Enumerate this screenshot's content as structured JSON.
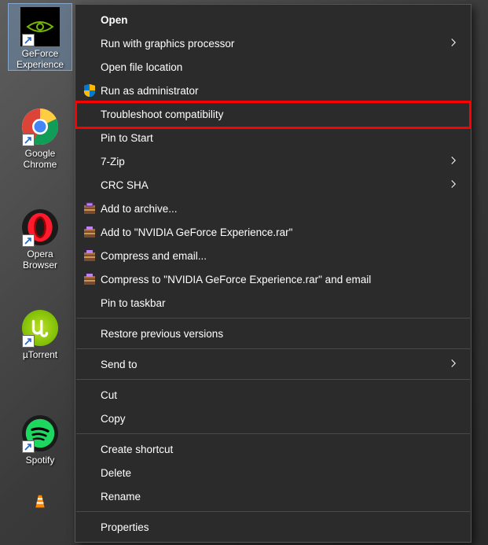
{
  "desktop": {
    "icons": [
      {
        "label": "GeForce\nExperience"
      },
      {
        "label": "Google\nChrome"
      },
      {
        "label": "Opera\nBrowser"
      },
      {
        "label": "µTorrent"
      },
      {
        "label": "Spotify"
      }
    ]
  },
  "menu": {
    "open": "Open",
    "run_graphics": "Run with graphics processor",
    "open_loc": "Open file location",
    "run_admin": "Run as administrator",
    "troubleshoot": "Troubleshoot compatibility",
    "pin_start": "Pin to Start",
    "sevenzip": "7-Zip",
    "crc": "CRC SHA",
    "add_archive": "Add to archive...",
    "add_rar": "Add to \"NVIDIA GeForce Experience.rar\"",
    "compress_email": "Compress and email...",
    "compress_rar_email": "Compress to \"NVIDIA GeForce Experience.rar\" and email",
    "pin_tb": "Pin to taskbar",
    "restore": "Restore previous versions",
    "sendto": "Send to",
    "cut": "Cut",
    "copy": "Copy",
    "shortcut": "Create shortcut",
    "delete": "Delete",
    "rename": "Rename",
    "properties": "Properties"
  }
}
